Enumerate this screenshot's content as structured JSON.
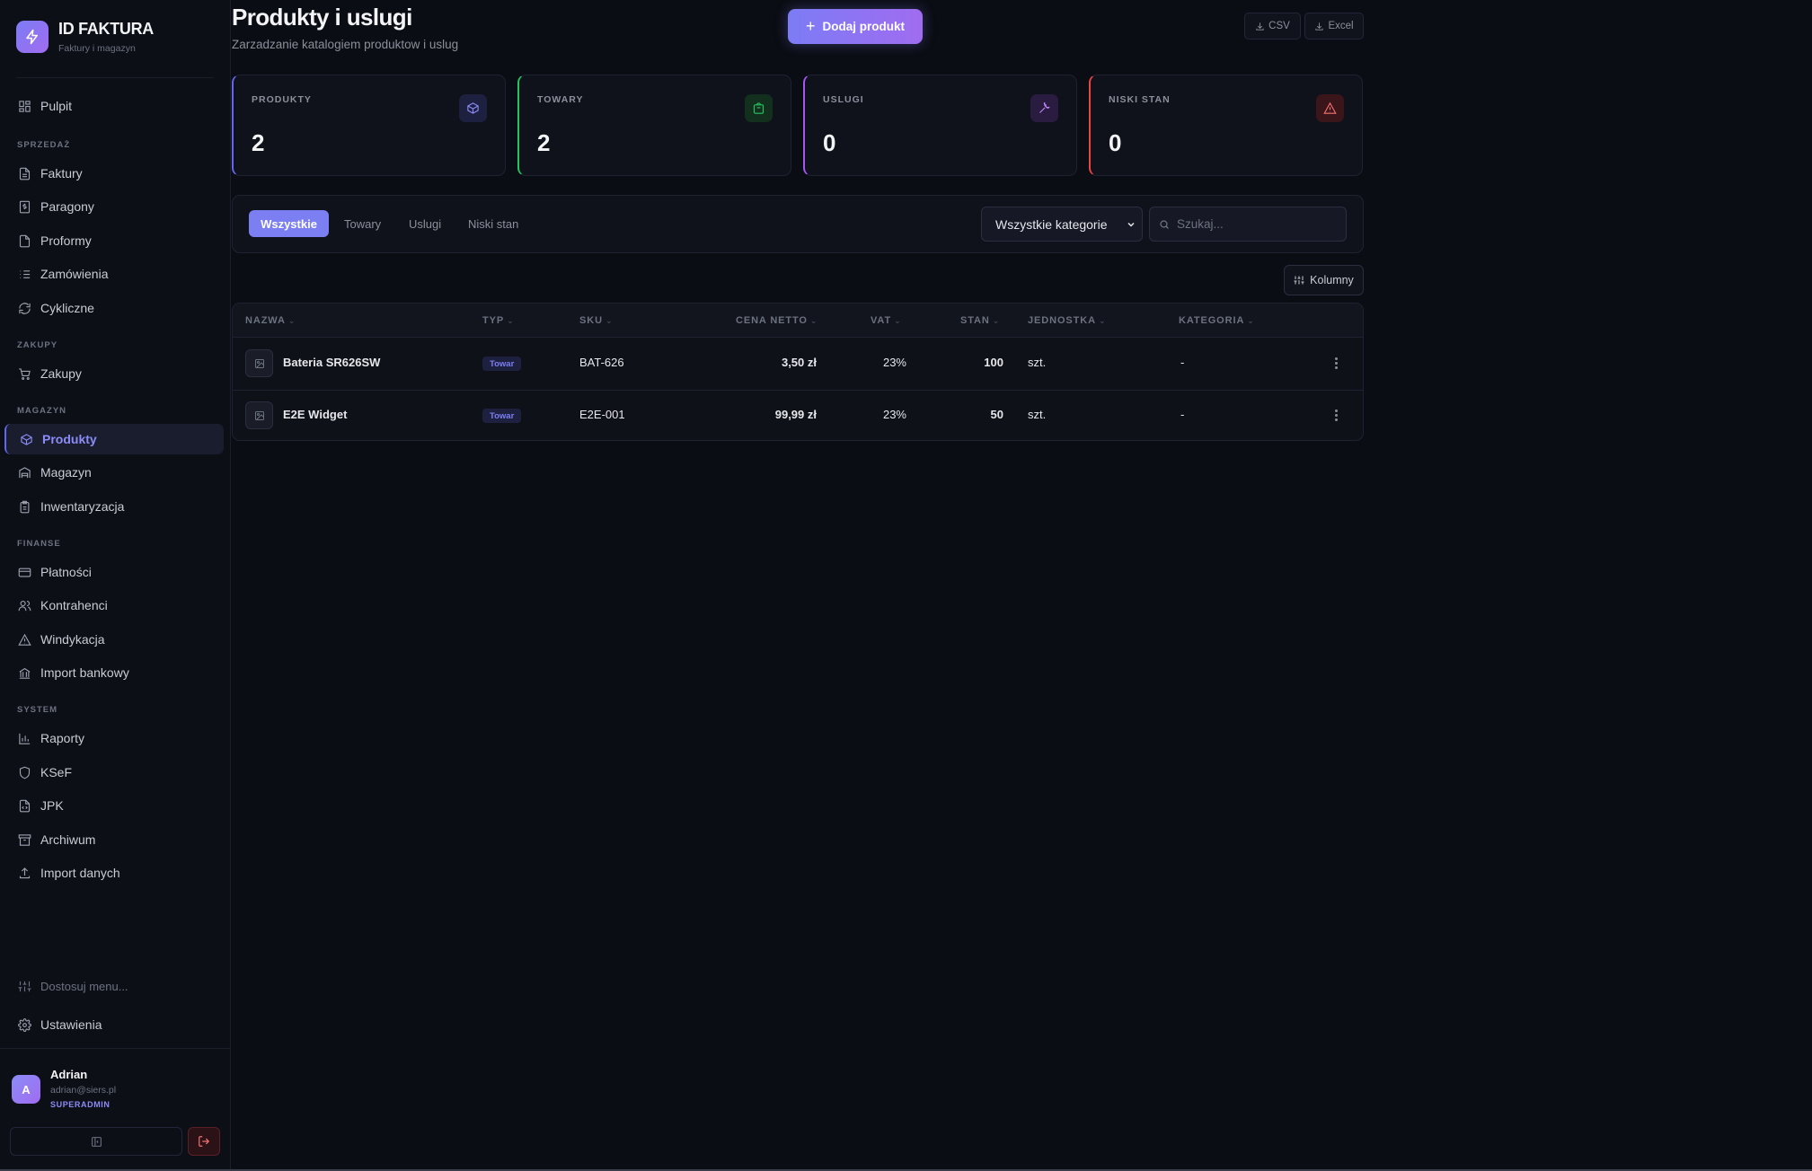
{
  "brand": {
    "title": "ID FAKTURA",
    "subtitle": "Faktury i magazyn"
  },
  "sidebar": {
    "items": [
      {
        "label": "Pulpit",
        "icon": "dashboard-icon"
      },
      {
        "section": "SPRZEDAŻ"
      },
      {
        "label": "Faktury",
        "icon": "file-icon"
      },
      {
        "label": "Paragony",
        "icon": "receipt-icon"
      },
      {
        "label": "Proformy",
        "icon": "file-icon"
      },
      {
        "label": "Zamówienia",
        "icon": "list-icon"
      },
      {
        "label": "Cykliczne",
        "icon": "refresh-icon"
      },
      {
        "section": "ZAKUPY"
      },
      {
        "label": "Zakupy",
        "icon": "cart-icon"
      },
      {
        "section": "MAGAZYN"
      },
      {
        "label": "Produkty",
        "icon": "box-icon",
        "active": true
      },
      {
        "label": "Magazyn",
        "icon": "warehouse-icon"
      },
      {
        "label": "Inwentaryzacja",
        "icon": "clipboard-icon"
      },
      {
        "section": "FINANSE"
      },
      {
        "label": "Płatności",
        "icon": "card-icon"
      },
      {
        "label": "Kontrahenci",
        "icon": "users-icon"
      },
      {
        "label": "Windykacja",
        "icon": "warning-icon"
      },
      {
        "label": "Import bankowy",
        "icon": "bank-icon"
      },
      {
        "section": "SYSTEM"
      },
      {
        "label": "Raporty",
        "icon": "chart-icon"
      },
      {
        "label": "KSeF",
        "icon": "shield-icon"
      },
      {
        "label": "JPK",
        "icon": "file-code-icon"
      },
      {
        "label": "Archiwum",
        "icon": "archive-icon"
      },
      {
        "label": "Import danych",
        "icon": "upload-icon"
      }
    ],
    "customize_label": "Dostosuj menu...",
    "settings_label": "Ustawienia"
  },
  "user": {
    "initial": "A",
    "name": "Adrian",
    "email": "adrian@siers.pl",
    "role": "SUPERADMIN"
  },
  "header": {
    "title": "Produkty i uslugi",
    "subtitle": "Zarzadzanie katalogiem produktow i uslug",
    "add_button": "Dodaj produkt",
    "csv_label": "CSV",
    "excel_label": "Excel"
  },
  "stats": [
    {
      "label": "PRODUKTY",
      "value": "2",
      "color": "#6366f1",
      "icon": "box-icon"
    },
    {
      "label": "TOWARY",
      "value": "2",
      "color": "#22c55e",
      "icon": "bag-icon"
    },
    {
      "label": "USLUGI",
      "value": "0",
      "color": "#a855f7",
      "icon": "wrench-icon"
    },
    {
      "label": "NISKI STAN",
      "value": "0",
      "color": "#ef4444",
      "icon": "alert-icon"
    }
  ],
  "filters": {
    "tabs": [
      "Wszystkie",
      "Towary",
      "Uslugi",
      "Niski stan"
    ],
    "active_tab": "Wszystkie",
    "category_selected": "Wszystkie kategorie",
    "search_placeholder": "Szukaj..."
  },
  "columns_button": "Kolumny",
  "table": {
    "headers": [
      "NAZWA",
      "TYP",
      "SKU",
      "CENA NETTO",
      "VAT",
      "STAN",
      "JEDNOSTKA",
      "KATEGORIA"
    ],
    "rows": [
      {
        "name": "Bateria SR626SW",
        "type": "Towar",
        "sku": "BAT-626",
        "price": "3,50 zł",
        "vat": "23%",
        "stock": "100",
        "unit": "szt.",
        "category": "-"
      },
      {
        "name": "E2E Widget",
        "type": "Towar",
        "sku": "E2E-001",
        "price": "99,99 zł",
        "vat": "23%",
        "stock": "50",
        "unit": "szt.",
        "category": "-"
      }
    ]
  }
}
